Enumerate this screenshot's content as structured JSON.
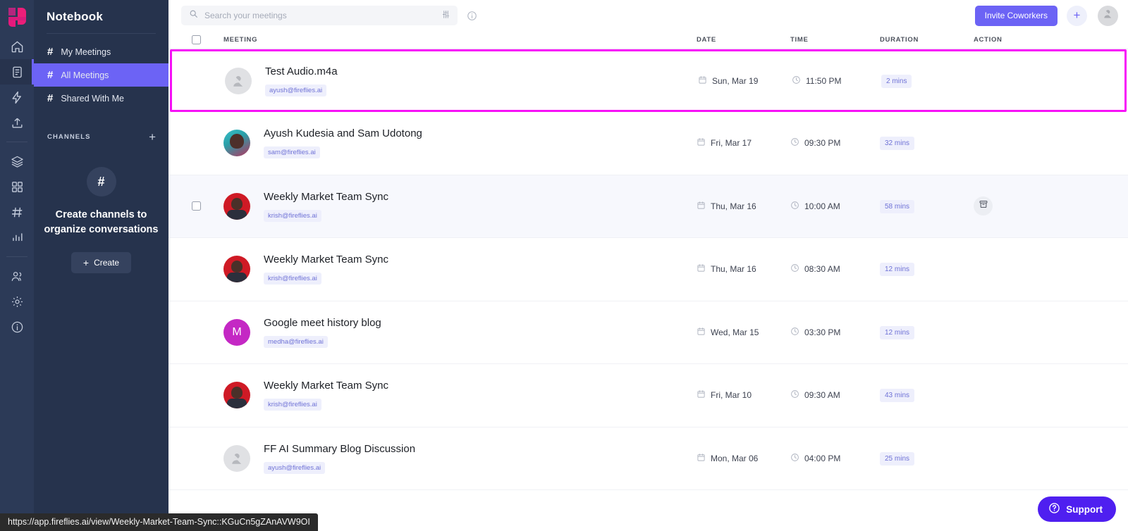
{
  "rail": {
    "logo_name": "fireflies-logo",
    "items": [
      {
        "icon": "home-icon",
        "active": false
      },
      {
        "icon": "document-icon",
        "active": true
      },
      {
        "icon": "lightning-icon",
        "active": false
      },
      {
        "icon": "upload-icon",
        "active": false
      },
      {
        "icon": "layers-icon",
        "active": false
      },
      {
        "icon": "grid-icon",
        "active": false
      },
      {
        "icon": "hash-icon",
        "active": false
      },
      {
        "icon": "chart-icon",
        "active": false
      },
      {
        "icon": "people-icon",
        "active": false
      },
      {
        "icon": "gear-icon",
        "active": false
      },
      {
        "icon": "info-icon",
        "active": false
      }
    ]
  },
  "sidebar": {
    "title": "Notebook",
    "items": [
      {
        "label": "My Meetings",
        "active": false
      },
      {
        "label": "All Meetings",
        "active": true
      },
      {
        "label": "Shared With Me",
        "active": false
      }
    ],
    "channels_label": "CHANNELS",
    "add_channel_icon": "plus-icon",
    "empty_icon": "hash-icon",
    "empty_text": "Create channels to organize conversations",
    "create_label": "Create",
    "active_color": "#6c63f5"
  },
  "topbar": {
    "search_placeholder": "Search your meetings",
    "search_value": "",
    "search_icon": "search-icon",
    "filter_icon": "filter-sliders-icon",
    "info_icon": "info-icon",
    "invite_label": "Invite Coworkers",
    "plus_label": "+",
    "avatar_icon": "user-muted-avatar",
    "accent_color": "#6c63f5"
  },
  "table": {
    "columns": [
      "MEETING",
      "DATE",
      "TIME",
      "DURATION",
      "ACTION"
    ],
    "select_all_checked": false,
    "selection_highlight_color": "#f712f7",
    "rows": [
      {
        "title": "Test Audio.m4a",
        "owner": "ayush@fireflies.ai",
        "date": "Sun, Mar 19",
        "time": "11:50 PM",
        "duration": "2 mins",
        "avatar_kind": "placeholder",
        "avatar_letter": "",
        "state": "selected",
        "action_icon": ""
      },
      {
        "title": "Ayush Kudesia and Sam Udotong",
        "owner": "sam@fireflies.ai",
        "date": "Fri, Mar 17",
        "time": "09:30 PM",
        "duration": "32 mins",
        "avatar_kind": "photo-teal",
        "avatar_letter": "",
        "state": "normal",
        "action_icon": ""
      },
      {
        "title": "Weekly Market Team Sync",
        "owner": "krish@fireflies.ai",
        "date": "Thu, Mar 16",
        "time": "10:00 AM",
        "duration": "58 mins",
        "avatar_kind": "photo-red",
        "avatar_letter": "",
        "state": "hovered",
        "action_icon": "archive-icon"
      },
      {
        "title": "Weekly Market Team Sync",
        "owner": "krish@fireflies.ai",
        "date": "Thu, Mar 16",
        "time": "08:30 AM",
        "duration": "12 mins",
        "avatar_kind": "photo-red",
        "avatar_letter": "",
        "state": "normal",
        "action_icon": ""
      },
      {
        "title": "Google meet history blog",
        "owner": "medha@fireflies.ai",
        "date": "Wed, Mar 15",
        "time": "03:30 PM",
        "duration": "12 mins",
        "avatar_kind": "letter",
        "avatar_letter": "M",
        "state": "normal",
        "action_icon": ""
      },
      {
        "title": "Weekly Market Team Sync",
        "owner": "krish@fireflies.ai",
        "date": "Fri, Mar 10",
        "time": "09:30 AM",
        "duration": "43 mins",
        "avatar_kind": "photo-red",
        "avatar_letter": "",
        "state": "normal",
        "action_icon": ""
      },
      {
        "title": "FF AI Summary Blog Discussion",
        "owner": "ayush@fireflies.ai",
        "date": "Mon, Mar 06",
        "time": "04:00 PM",
        "duration": "25 mins",
        "avatar_kind": "placeholder",
        "avatar_letter": "",
        "state": "normal",
        "action_icon": ""
      }
    ]
  },
  "status_bar": {
    "url": "https://app.fireflies.ai/view/Weekly-Market-Team-Sync::KGuCn5gZAnAVW9OI"
  },
  "support": {
    "label": "Support",
    "icon": "question-circle-icon",
    "color": "#4f1ff0"
  }
}
